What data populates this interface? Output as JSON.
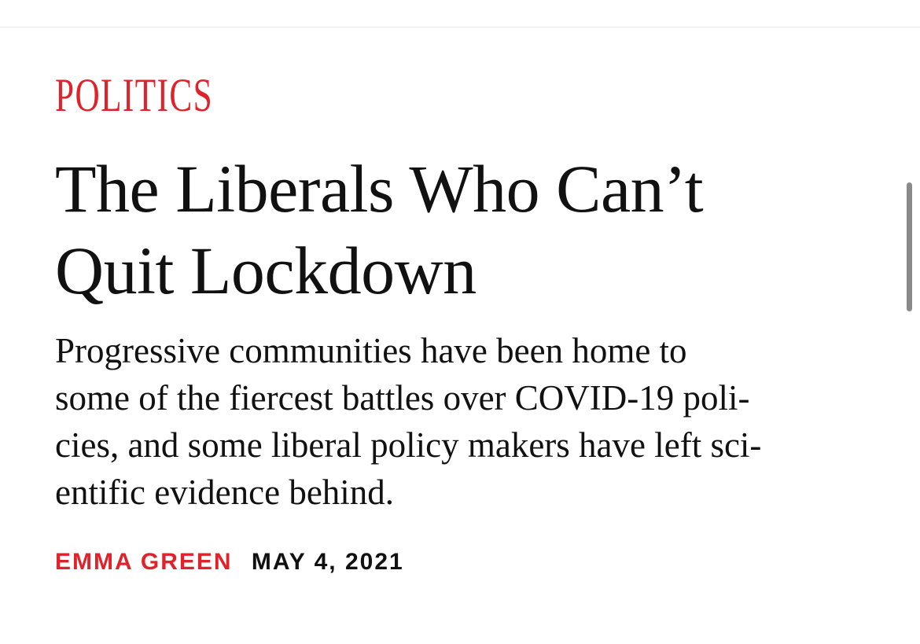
{
  "article": {
    "section": "POLITICS",
    "headline_line1": "The Liberals Who Can’t",
    "headline_line2": "Quit Lockdown",
    "dek_line1": "Progressive communities have been home to",
    "dek_line2": "some of the fiercest battles over COVID-19 poli-",
    "dek_line3": "cies, and some liberal policy makers have left sci-",
    "dek_line4": "entific evidence behind.",
    "author": "EMMA GREEN",
    "date": "MAY 4, 2021"
  },
  "colors": {
    "accent": "#e0232a",
    "text": "#111111",
    "background": "#ffffff",
    "scrollbar": "#8a8a8a"
  }
}
